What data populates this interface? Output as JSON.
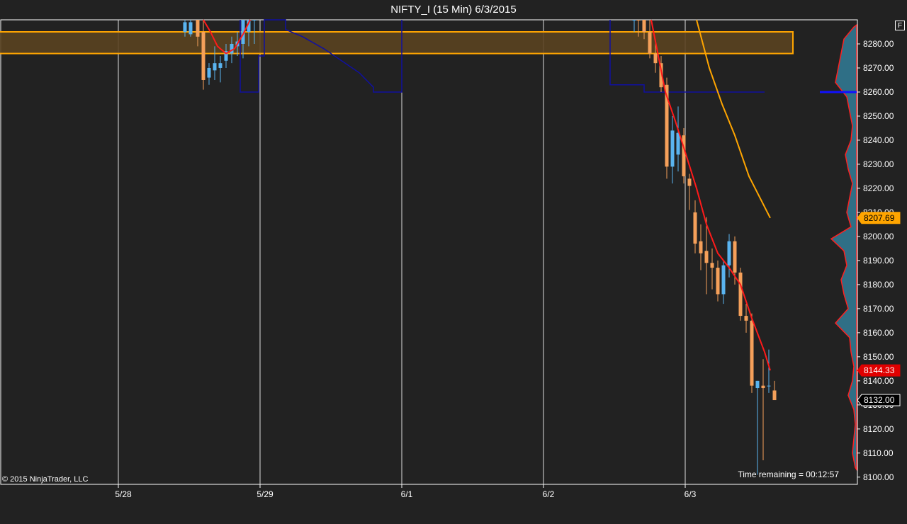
{
  "window": {
    "title": "NIFTY_I (15 Min)  6/3/2015"
  },
  "footer": {
    "copyright": "© 2015 NinjaTrader, LLC",
    "time_remaining": "Time remaining = 00:12:57",
    "f_button": "F"
  },
  "colors": {
    "background": "#222222",
    "up_candle": "#5ab4f0",
    "down_candle": "#f5a05a",
    "ma_fast": "#ff1a1a",
    "ma_slow": "#ffa500",
    "zone_fill": "#5a4320",
    "zone_border": "#ffa500",
    "step_line": "#1010a0",
    "volume_profile": "#2f6f86",
    "profile_edge": "#ff2020"
  },
  "chart_data": {
    "type": "candlestick",
    "symbol": "NIFTY_I",
    "interval": "15 Min",
    "date": "6/3/2015",
    "ylim": [
      8097,
      8290
    ],
    "y_ticks": [
      8100,
      8110,
      8120,
      8130,
      8140,
      8150,
      8160,
      8170,
      8180,
      8190,
      8200,
      8210,
      8220,
      8230,
      8240,
      8250,
      8260,
      8270,
      8280
    ],
    "y_tick_format": "2dp",
    "x_ticks": [
      {
        "label": "5/28",
        "t": 0
      },
      {
        "label": "5/29",
        "t": 1
      },
      {
        "label": "6/1",
        "t": 2
      },
      {
        "label": "6/2",
        "t": 3
      },
      {
        "label": "6/3",
        "t": 4
      }
    ],
    "session_lines": [
      0,
      1,
      2,
      3,
      4
    ],
    "price_labels": [
      {
        "value": 8207.69,
        "text": "8207.69",
        "style": "orange"
      },
      {
        "value": 8144.33,
        "text": "8144.33",
        "style": "red"
      },
      {
        "value": 8132.0,
        "text": "8132.00",
        "style": "current"
      }
    ],
    "zone": {
      "top": 8285,
      "bottom": 8276,
      "t_start": -0.84,
      "t_end": 4.76
    },
    "candles": [
      {
        "t": 0.47,
        "o": 8285,
        "h": 8292,
        "l": 8283,
        "c": 8289
      },
      {
        "t": 0.51,
        "o": 8284,
        "h": 8292,
        "l": 8283,
        "c": 8289
      },
      {
        "t": 0.56,
        "o": 8290,
        "h": 8292,
        "l": 8279,
        "c": 8283
      },
      {
        "t": 0.6,
        "o": 8285,
        "h": 8292,
        "l": 8261,
        "c": 8265
      },
      {
        "t": 0.64,
        "o": 8266,
        "h": 8272,
        "l": 8263,
        "c": 8270
      },
      {
        "t": 0.68,
        "o": 8269,
        "h": 8279,
        "l": 8265,
        "c": 8272
      },
      {
        "t": 0.72,
        "o": 8270,
        "h": 8275,
        "l": 8264,
        "c": 8272
      },
      {
        "t": 0.76,
        "o": 8273,
        "h": 8280,
        "l": 8270,
        "c": 8277
      },
      {
        "t": 0.8,
        "o": 8276,
        "h": 8283,
        "l": 8272,
        "c": 8280
      },
      {
        "t": 0.84,
        "o": 8279,
        "h": 8285,
        "l": 8275,
        "c": 8281
      },
      {
        "t": 0.88,
        "o": 8280,
        "h": 8292,
        "l": 8274,
        "c": 8291
      },
      {
        "t": 0.92,
        "o": 8285,
        "h": 8292,
        "l": 8279,
        "c": 8291
      },
      {
        "t": 0.96,
        "o": 8290,
        "h": 8292,
        "l": 8280,
        "c": 8292
      },
      {
        "t": 3.64,
        "o": 8290,
        "h": 8292,
        "l": 8285,
        "c": 8292
      },
      {
        "t": 3.67,
        "o": 8292,
        "h": 8293,
        "l": 8283,
        "c": 8290
      },
      {
        "t": 3.71,
        "o": 8290,
        "h": 8292,
        "l": 8282,
        "c": 8285
      },
      {
        "t": 3.75,
        "o": 8285,
        "h": 8290,
        "l": 8274,
        "c": 8276
      },
      {
        "t": 3.79,
        "o": 8276,
        "h": 8282,
        "l": 8268,
        "c": 8272
      },
      {
        "t": 3.83,
        "o": 8272,
        "h": 8275,
        "l": 8260,
        "c": 8262
      },
      {
        "t": 3.87,
        "o": 8263,
        "h": 8266,
        "l": 8224,
        "c": 8229
      },
      {
        "t": 3.91,
        "o": 8229,
        "h": 8250,
        "l": 8222,
        "c": 8244
      },
      {
        "t": 3.95,
        "o": 8234,
        "h": 8254,
        "l": 8227,
        "c": 8243
      },
      {
        "t": 3.99,
        "o": 8242,
        "h": 8245,
        "l": 8222,
        "c": 8225
      },
      {
        "t": 4.03,
        "o": 8224,
        "h": 8226,
        "l": 8211,
        "c": 8221
      },
      {
        "t": 4.07,
        "o": 8210,
        "h": 8215,
        "l": 8193,
        "c": 8197
      },
      {
        "t": 4.11,
        "o": 8198,
        "h": 8205,
        "l": 8186,
        "c": 8193
      },
      {
        "t": 4.15,
        "o": 8194,
        "h": 8208,
        "l": 8176,
        "c": 8189
      },
      {
        "t": 4.19,
        "o": 8189,
        "h": 8195,
        "l": 8178,
        "c": 8187
      },
      {
        "t": 4.23,
        "o": 8187,
        "h": 8190,
        "l": 8173,
        "c": 8176
      },
      {
        "t": 4.27,
        "o": 8176,
        "h": 8190,
        "l": 8172,
        "c": 8188
      },
      {
        "t": 4.31,
        "o": 8188,
        "h": 8201,
        "l": 8183,
        "c": 8198
      },
      {
        "t": 4.35,
        "o": 8198,
        "h": 8200,
        "l": 8180,
        "c": 8185
      },
      {
        "t": 4.39,
        "o": 8185,
        "h": 8187,
        "l": 8165,
        "c": 8167
      },
      {
        "t": 4.43,
        "o": 8167,
        "h": 8172,
        "l": 8160,
        "c": 8165
      },
      {
        "t": 4.47,
        "o": 8165,
        "h": 8168,
        "l": 8135,
        "c": 8138
      },
      {
        "t": 4.51,
        "o": 8137,
        "h": 8140,
        "l": 8101,
        "c": 8140
      },
      {
        "t": 4.55,
        "o": 8138,
        "h": 8149,
        "l": 8107,
        "c": 8137
      },
      {
        "t": 4.59,
        "o": 8138,
        "h": 8153,
        "l": 8135,
        "c": 8138
      },
      {
        "t": 4.63,
        "o": 8136,
        "h": 8140,
        "l": 8132,
        "c": 8132
      }
    ],
    "ma_fast": {
      "segments": [
        [
          [
            0.6,
            8292
          ],
          [
            0.65,
            8285
          ],
          [
            0.7,
            8279
          ],
          [
            0.76,
            8276
          ],
          [
            0.82,
            8278
          ],
          [
            0.88,
            8284
          ],
          [
            0.93,
            8290
          ]
        ],
        [
          [
            3.76,
            8292
          ],
          [
            3.81,
            8275
          ],
          [
            3.86,
            8260
          ],
          [
            3.93,
            8248
          ],
          [
            4.0,
            8235
          ],
          [
            4.08,
            8220
          ],
          [
            4.15,
            8205
          ],
          [
            4.23,
            8193
          ],
          [
            4.31,
            8187
          ],
          [
            4.39,
            8180
          ],
          [
            4.47,
            8166
          ],
          [
            4.56,
            8152
          ],
          [
            4.6,
            8144.33
          ]
        ]
      ]
    },
    "ma_slow": {
      "segments": [
        [
          [
            4.08,
            8292
          ],
          [
            4.17,
            8270
          ],
          [
            4.26,
            8255
          ],
          [
            4.35,
            8242
          ],
          [
            4.45,
            8225
          ],
          [
            4.6,
            8207.69
          ]
        ]
      ]
    },
    "step_line": {
      "segments": [
        [
          [
            0.86,
            8292
          ],
          [
            0.86,
            8260
          ],
          [
            0.99,
            8260
          ],
          [
            0.99,
            8275
          ],
          [
            1.03,
            8275
          ],
          [
            1.03,
            8290
          ],
          [
            1.18,
            8290
          ],
          [
            1.18,
            8286
          ],
          [
            1.3,
            8283
          ],
          [
            1.45,
            8278
          ],
          [
            1.6,
            8272
          ],
          [
            1.7,
            8268
          ],
          [
            1.75,
            8265
          ],
          [
            1.8,
            8262
          ],
          [
            1.8,
            8260
          ],
          [
            2.0,
            8260
          ],
          [
            2.0,
            8292
          ]
        ],
        [
          [
            3.47,
            8292
          ],
          [
            3.47,
            8263
          ],
          [
            3.71,
            8263
          ],
          [
            3.71,
            8260
          ],
          [
            4.56,
            8260
          ]
        ]
      ]
    },
    "volume_profile": [
      [
        8287,
        4
      ],
      [
        8282,
        18
      ],
      [
        8276,
        22
      ],
      [
        8270,
        26
      ],
      [
        8264,
        30
      ],
      [
        8258,
        14
      ],
      [
        8252,
        10
      ],
      [
        8246,
        6
      ],
      [
        8240,
        8
      ],
      [
        8234,
        16
      ],
      [
        8228,
        12
      ],
      [
        8222,
        6
      ],
      [
        8216,
        10
      ],
      [
        8210,
        14
      ],
      [
        8204,
        8
      ],
      [
        8199,
        36
      ],
      [
        8194,
        18
      ],
      [
        8188,
        14
      ],
      [
        8182,
        22
      ],
      [
        8176,
        18
      ],
      [
        8170,
        12
      ],
      [
        8164,
        30
      ],
      [
        8158,
        10
      ],
      [
        8152,
        8
      ],
      [
        8146,
        4
      ],
      [
        8140,
        6
      ],
      [
        8134,
        12
      ],
      [
        8128,
        4
      ],
      [
        8122,
        2
      ],
      [
        8116,
        4
      ],
      [
        8110,
        6
      ],
      [
        8104,
        2
      ]
    ]
  }
}
